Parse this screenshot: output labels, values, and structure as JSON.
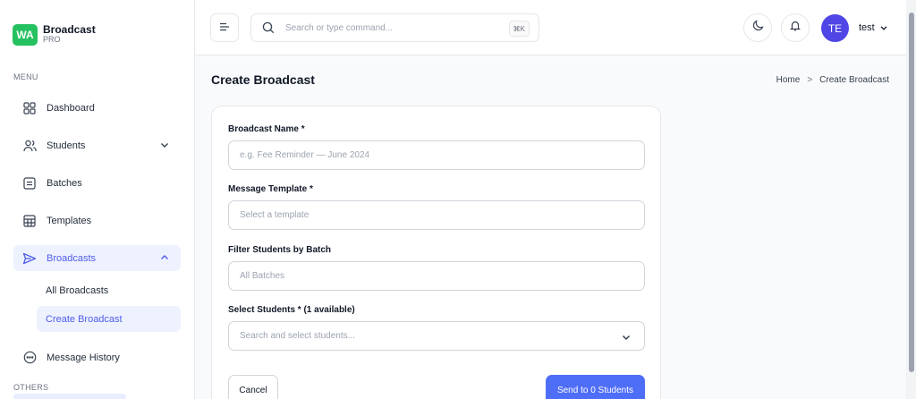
{
  "brand": {
    "badge": "WA",
    "title": "Broadcast",
    "subtitle": "PRO",
    "badge_color": "#25c160"
  },
  "sidebar": {
    "menu_label": "MENU",
    "others_label": "OTHERS",
    "items": [
      {
        "label": "Dashboard",
        "icon": "grid-icon"
      },
      {
        "label": "Students",
        "icon": "users-icon",
        "expandable": true
      },
      {
        "label": "Batches",
        "icon": "list-box-icon"
      },
      {
        "label": "Templates",
        "icon": "table-icon"
      },
      {
        "label": "Broadcasts",
        "icon": "send-icon",
        "active": true,
        "expanded": true
      },
      {
        "label": "Message History",
        "icon": "chat-icon"
      }
    ],
    "broadcast_sub": [
      {
        "label": "All Broadcasts"
      },
      {
        "label": "Create Broadcast",
        "active": true
      }
    ]
  },
  "header": {
    "search_placeholder": "Search or type command...",
    "shortcut": "⌘K",
    "avatar_initials": "TE",
    "user_name": "test"
  },
  "page": {
    "title": "Create Broadcast",
    "breadcrumb": {
      "home": "Home",
      "sep": ">",
      "current": "Create Broadcast"
    }
  },
  "form": {
    "name_label": "Broadcast Name *",
    "name_placeholder": "e.g. Fee Reminder — June 2024",
    "template_label": "Message Template *",
    "template_placeholder": "Select a template",
    "batch_label": "Filter Students by Batch",
    "batch_placeholder": "All Batches",
    "students_label": "Select Students * (1 available)",
    "students_placeholder": "Search and select students...",
    "cancel_label": "Cancel",
    "send_label": "Send to 0 Students"
  },
  "colors": {
    "accent": "#4f5ce8",
    "primary_button": "#4f6ef7",
    "avatar": "#4f46e5"
  }
}
